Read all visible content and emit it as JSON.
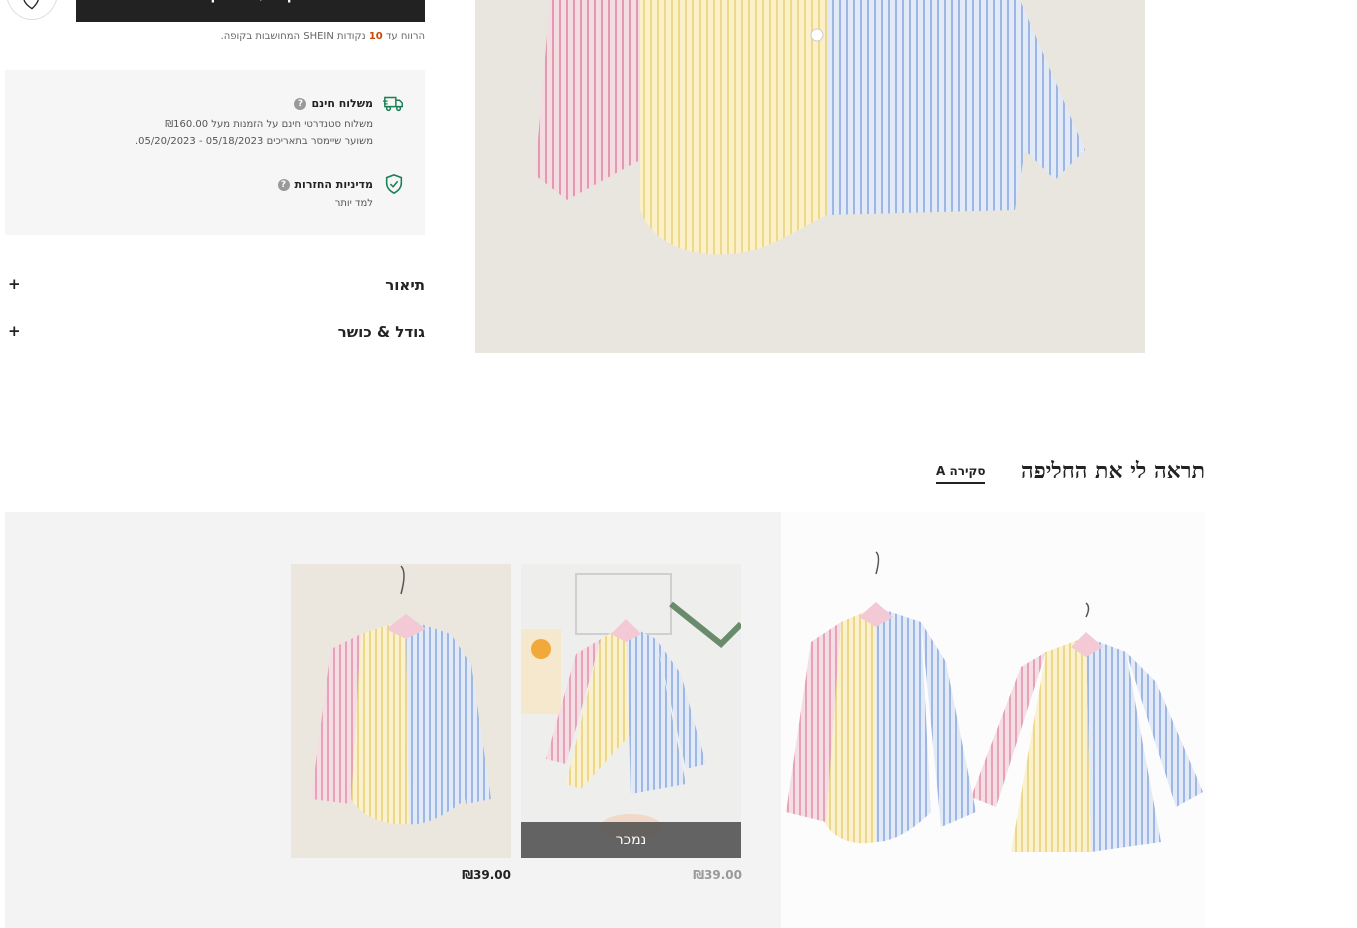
{
  "purchase": {
    "add_to_bag_label": "הוסף לעגלת הקניות",
    "wishlist_icon": "heart-icon",
    "points_pre": "הרווח עד",
    "points_value": "10",
    "points_post": "נקודות SHEIN המחושבות בקופה."
  },
  "shipping": {
    "free_title": "משלוח חינם",
    "free_line1": "משלוח סטנדרטי חינם על הזמנות מעל ₪160.00",
    "free_line2": "משוער שיימסר בתאריכים 05/18/2023 - 05/20/2023.",
    "returns_title": "מדיניות החזרות",
    "returns_link": "למד יותר",
    "help_glyph": "?",
    "truck_icon": "truck-icon",
    "shield_icon": "shield-check-icon",
    "accent_color": "#198055"
  },
  "accordions": [
    {
      "label": "תיאור",
      "toggle": "+"
    },
    {
      "label": "גודל & כושר",
      "toggle": "+"
    }
  ],
  "outfit": {
    "title": "תראה לי את החליפה",
    "tab_label": "סקירה A",
    "items": [
      {
        "price": "₪39.00",
        "sold_out": false
      },
      {
        "price": "₪39.00",
        "sold_out": true,
        "sold_out_label": "נמכר"
      }
    ]
  }
}
